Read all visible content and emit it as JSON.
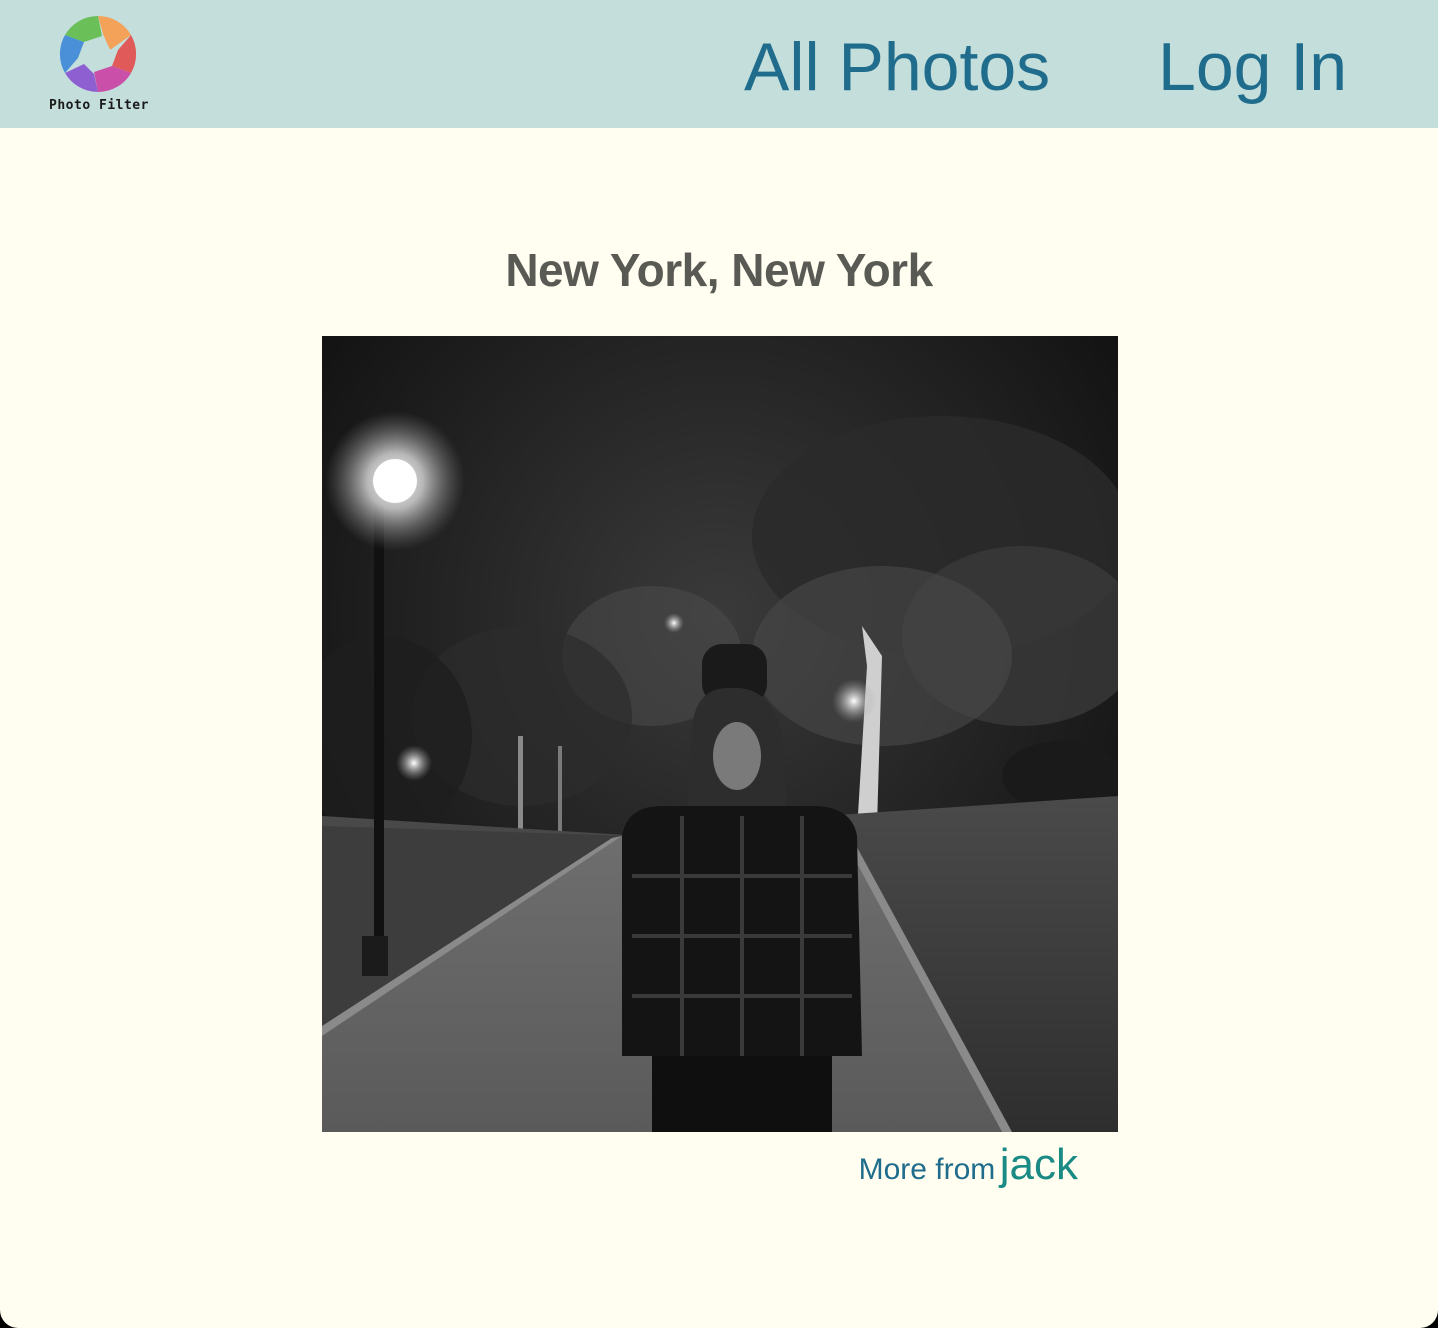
{
  "brand": {
    "logo_text": "Photo Filter",
    "logo_colors": [
      "#f4a259",
      "#e05a5a",
      "#c94fa8",
      "#8e5fd1",
      "#4a90d9",
      "#6abf59"
    ]
  },
  "nav": {
    "all_photos_label": "All Photos",
    "login_label": "Log In",
    "link_color": "#1f6c8c",
    "bar_color": "#c3dedb"
  },
  "photo": {
    "title": "New York, New York",
    "more_from_label": "More from",
    "author": "jack",
    "description_hint": "black-and-white night portrait on park path"
  },
  "colors": {
    "background": "#fffef0",
    "title": "#5a5a55",
    "author_link": "#1a8a84"
  }
}
